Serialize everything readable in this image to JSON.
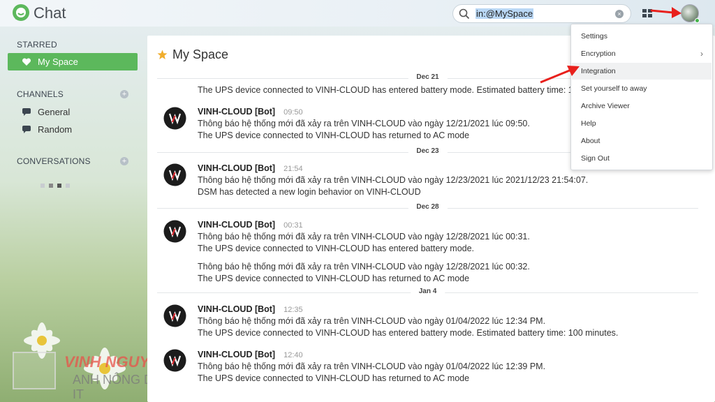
{
  "app": {
    "title": "Chat"
  },
  "search": {
    "value": "in:@MySpace",
    "clear_label": "×"
  },
  "sidebar": {
    "starred_heading": "STARRED",
    "starred_item": "My Space",
    "channels_heading": "CHANNELS",
    "channels": [
      {
        "label": "General"
      },
      {
        "label": "Random"
      }
    ],
    "conversations_heading": "CONVERSATIONS",
    "add_symbol": "+"
  },
  "main": {
    "title": "My Space",
    "groups": [
      {
        "date": "Dec 21",
        "continuation": [
          "The UPS device connected to VINH-CLOUD has entered battery mode. Estimated battery time: 1"
        ],
        "messages": [
          {
            "sender": "VINH-CLOUD [Bot]",
            "time": "09:50",
            "lines": [
              "Thông báo hệ thống mới đã xảy ra trên VINH-CLOUD vào ngày 12/21/2021 lúc 09:50.",
              "The UPS device connected to VINH-CLOUD has returned to AC mode"
            ]
          }
        ]
      },
      {
        "date": "Dec 23",
        "messages": [
          {
            "sender": "VINH-CLOUD [Bot]",
            "time": "21:54",
            "lines": [
              "Thông báo hệ thống mới đã xảy ra trên VINH-CLOUD vào ngày 12/23/2021 lúc 2021/12/23 21:54:07.",
              "DSM has detected a new login behavior on VINH-CLOUD"
            ]
          }
        ]
      },
      {
        "date": "Dec 28",
        "messages": [
          {
            "sender": "VINH-CLOUD [Bot]",
            "time": "00:31",
            "lines": [
              "Thông báo hệ thống mới đã xảy ra trên VINH-CLOUD vào ngày 12/28/2021 lúc 00:31.",
              "The UPS device connected to VINH-CLOUD has entered battery mode."
            ],
            "followup": [
              "Thông báo hệ thống mới đã xảy ra trên VINH-CLOUD vào ngày 12/28/2021 lúc 00:32.",
              "The UPS device connected to VINH-CLOUD has returned to AC mode"
            ]
          }
        ]
      },
      {
        "date": "Jan 4",
        "messages": [
          {
            "sender": "VINH-CLOUD [Bot]",
            "time": "12:35",
            "lines": [
              "Thông báo hệ thống mới đã xảy ra trên VINH-CLOUD vào ngày 01/04/2022 lúc 12:34 PM.",
              "The UPS device connected to VINH-CLOUD has entered battery mode. Estimated battery time: 100 minutes."
            ]
          },
          {
            "sender": "VINH-CLOUD [Bot]",
            "time": "12:40",
            "lines": [
              "Thông báo hệ thống mới đã xảy ra trên VINH-CLOUD vào ngày 01/04/2022 lúc 12:39 PM.",
              "The UPS device connected to VINH-CLOUD has returned to AC mode"
            ]
          }
        ]
      }
    ]
  },
  "menu": {
    "items": [
      {
        "label": "Settings"
      },
      {
        "label": "Encryption",
        "chevron": "›"
      },
      {
        "label": "Integration"
      },
      {
        "label": "Set yourself to away"
      },
      {
        "label": "Archive Viewer"
      },
      {
        "label": "Help"
      },
      {
        "label": "About"
      },
      {
        "label": "Sign Out"
      }
    ]
  },
  "watermark": {
    "line1": "VINH NGUYÊN",
    "line2": "ANH NÔNG DÂN IT"
  },
  "colors": {
    "accent": "#5cb85c",
    "arrow": "#e8201c",
    "star": "#f0ad2c"
  }
}
